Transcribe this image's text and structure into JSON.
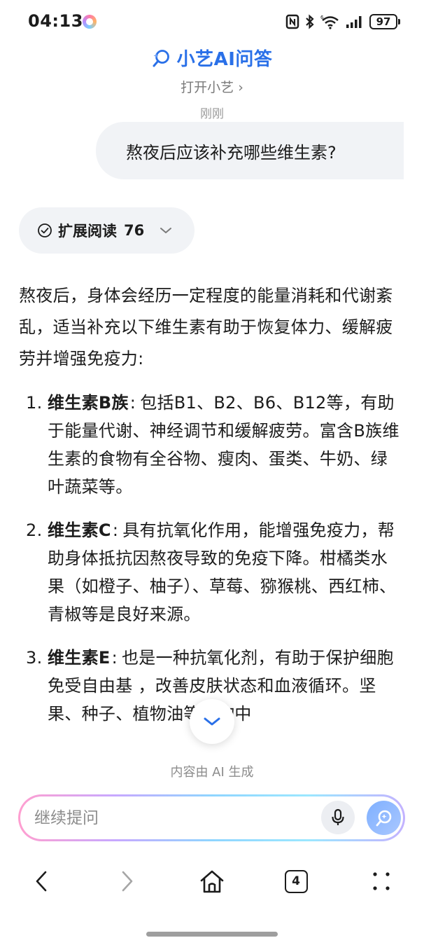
{
  "status_bar": {
    "time": "04:13",
    "battery": "97",
    "icons": [
      "nfc-icon",
      "bluetooth-icon",
      "wifi-icon",
      "signal-icon",
      "battery-icon"
    ]
  },
  "header": {
    "title": "小艺AI问答",
    "open_link": "打开小艺 ›",
    "timestamp": "刚刚"
  },
  "user_message": "熬夜后应该补充哪些维生素?",
  "extended_reading": {
    "label": "扩展阅读",
    "count": "76"
  },
  "answer": {
    "intro": "熬夜后，身体会经历一定程度的能量消耗和代谢紊乱，适当补充以下维生素有助于恢复体力、缓解疲劳并增强免疫力:",
    "items": [
      {
        "number": "1.",
        "name": "维生素B族",
        "colon": ":",
        "text": "包括B1、B2、B6、B12等，有助于能量代谢、神经调节和缓解疲劳。富含B族维生素的食物有全谷物、瘦肉、蛋类、牛奶、绿叶蔬菜等。"
      },
      {
        "number": "2.",
        "name": "维生素C",
        "colon": ":",
        "text": "具有抗氧化作用，能增强免疫力，帮助身体抵抗因熬夜导致的免疫下降。柑橘类水果（如橙子、柚子）、草莓、猕猴桃、西红柿、青椒等是良好来源。"
      },
      {
        "number": "3.",
        "name": "维生素E",
        "colon": ":",
        "text": "也是一种抗氧化剂，有助于保护细胞免受自由基    ，改善皮肤状态和血液循环。坚果、种子、植物油等食物中"
      }
    ]
  },
  "ai_note": "内容由 AI 生成",
  "input": {
    "placeholder": "继续提问"
  },
  "bottom_nav": {
    "tab_count": "4"
  },
  "colors": {
    "accent": "#2a70e8",
    "bubble_bg": "#f1f3f6",
    "send_button": "#8fb8ff"
  }
}
